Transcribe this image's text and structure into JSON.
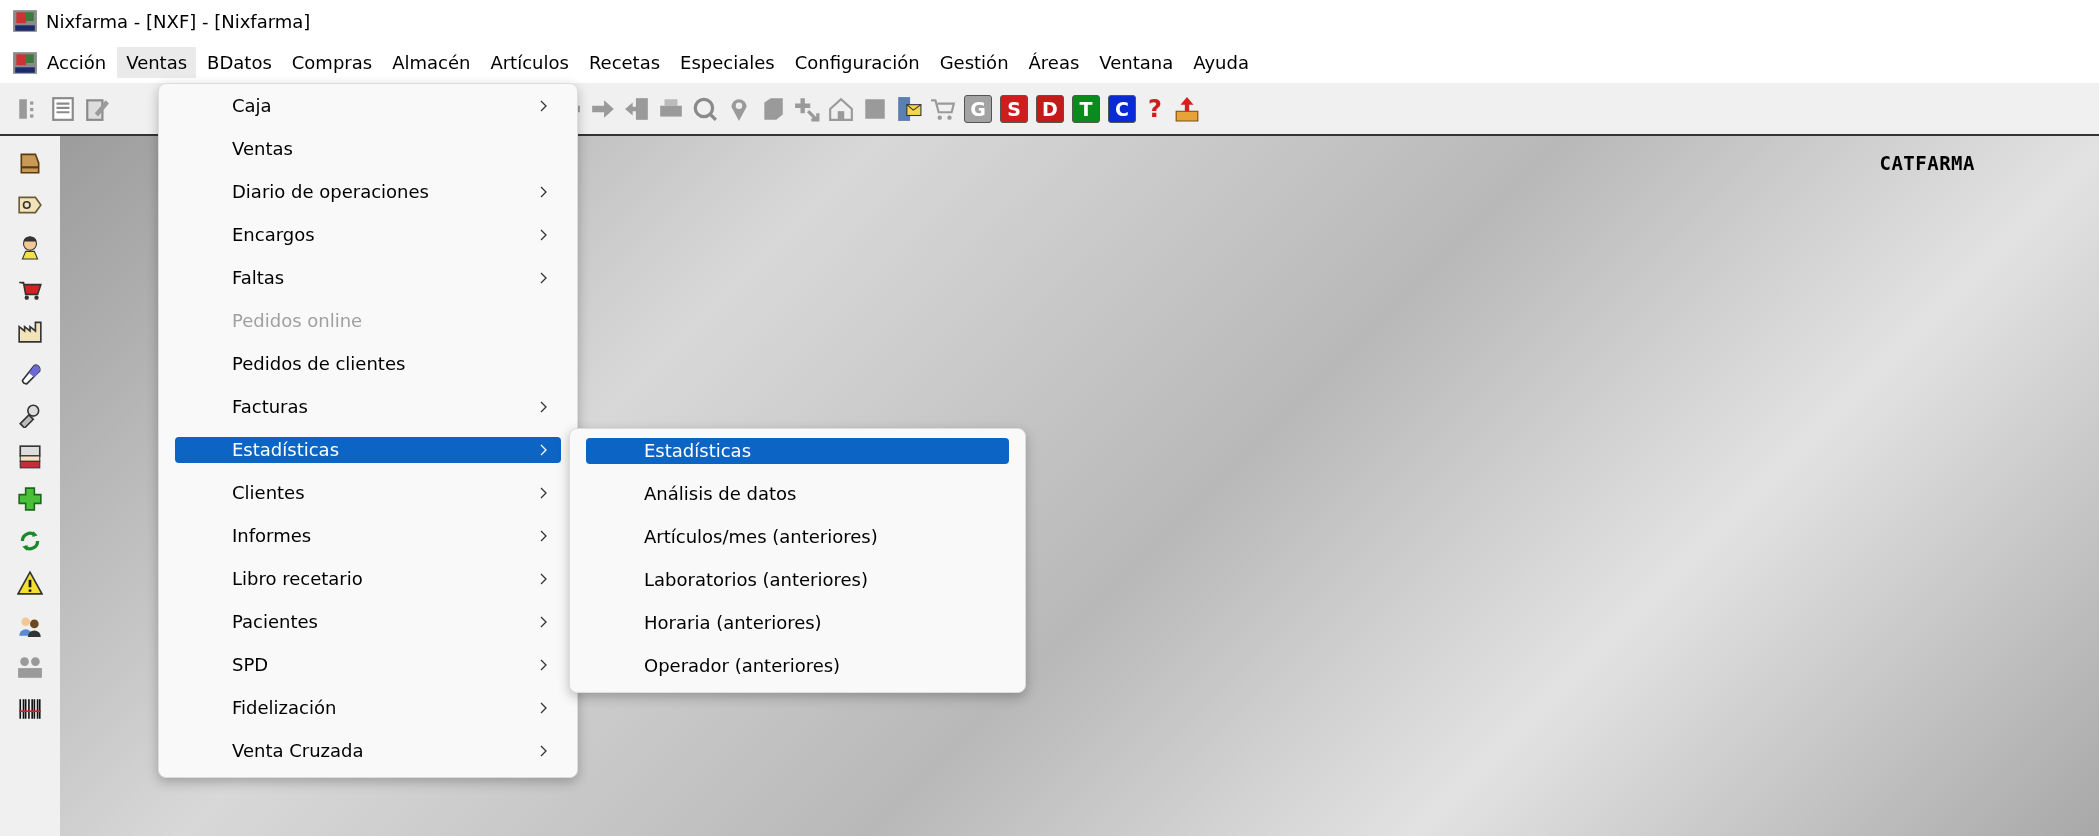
{
  "window": {
    "title": "Nixfarma - [NXF] - [Nixfarma]"
  },
  "menu_bar": [
    {
      "label": "Acción",
      "selected": false
    },
    {
      "label": "Ventas",
      "selected": true
    },
    {
      "label": "BDatos",
      "selected": false
    },
    {
      "label": "Compras",
      "selected": false
    },
    {
      "label": "Almacén",
      "selected": false
    },
    {
      "label": "Artículos",
      "selected": false
    },
    {
      "label": "Recetas",
      "selected": false
    },
    {
      "label": "Especiales",
      "selected": false
    },
    {
      "label": "Configuración",
      "selected": false
    },
    {
      "label": "Gestión",
      "selected": false
    },
    {
      "label": "Áreas",
      "selected": false
    },
    {
      "label": "Ventana",
      "selected": false
    },
    {
      "label": "Ayuda",
      "selected": false
    }
  ],
  "toolbar": {
    "letter_buttons": [
      {
        "label": "G",
        "color": "#a3a3a3"
      },
      {
        "label": "S",
        "color": "#d01c1c"
      },
      {
        "label": "D",
        "color": "#c41a1a"
      },
      {
        "label": "T",
        "color": "#0b8a1e"
      },
      {
        "label": "C",
        "color": "#0a2ad6"
      }
    ],
    "help_label": "?"
  },
  "workspace": {
    "label": "CATFARMA"
  },
  "ventas_menu": [
    {
      "label": "Caja",
      "submenu": true,
      "disabled": false,
      "selected": false
    },
    {
      "label": "Ventas",
      "submenu": false,
      "disabled": false,
      "selected": false
    },
    {
      "label": "Diario de operaciones",
      "submenu": true,
      "disabled": false,
      "selected": false
    },
    {
      "label": "Encargos",
      "submenu": true,
      "disabled": false,
      "selected": false
    },
    {
      "label": "Faltas",
      "submenu": true,
      "disabled": false,
      "selected": false
    },
    {
      "label": "Pedidos online",
      "submenu": false,
      "disabled": true,
      "selected": false
    },
    {
      "label": "Pedidos de clientes",
      "submenu": false,
      "disabled": false,
      "selected": false
    },
    {
      "label": "Facturas",
      "submenu": true,
      "disabled": false,
      "selected": false
    },
    {
      "label": "Estadísticas",
      "submenu": true,
      "disabled": false,
      "selected": true
    },
    {
      "label": "Clientes",
      "submenu": true,
      "disabled": false,
      "selected": false
    },
    {
      "label": "Informes",
      "submenu": true,
      "disabled": false,
      "selected": false
    },
    {
      "label": "Libro recetario",
      "submenu": true,
      "disabled": false,
      "selected": false
    },
    {
      "label": "Pacientes",
      "submenu": true,
      "disabled": false,
      "selected": false
    },
    {
      "label": "SPD",
      "submenu": true,
      "disabled": false,
      "selected": false
    },
    {
      "label": "Fidelización",
      "submenu": true,
      "disabled": false,
      "selected": false
    },
    {
      "label": "Venta Cruzada",
      "submenu": true,
      "disabled": false,
      "selected": false
    }
  ],
  "estadisticas_submenu": [
    {
      "label": "Estadísticas",
      "selected": true
    },
    {
      "label": "Análisis de datos",
      "selected": false
    },
    {
      "label": "Artículos/mes (anteriores)",
      "selected": false
    },
    {
      "label": "Laboratorios (anteriores)",
      "selected": false
    },
    {
      "label": "Horaria (anteriores)",
      "selected": false
    },
    {
      "label": "Operador (anteriores)",
      "selected": false
    }
  ]
}
